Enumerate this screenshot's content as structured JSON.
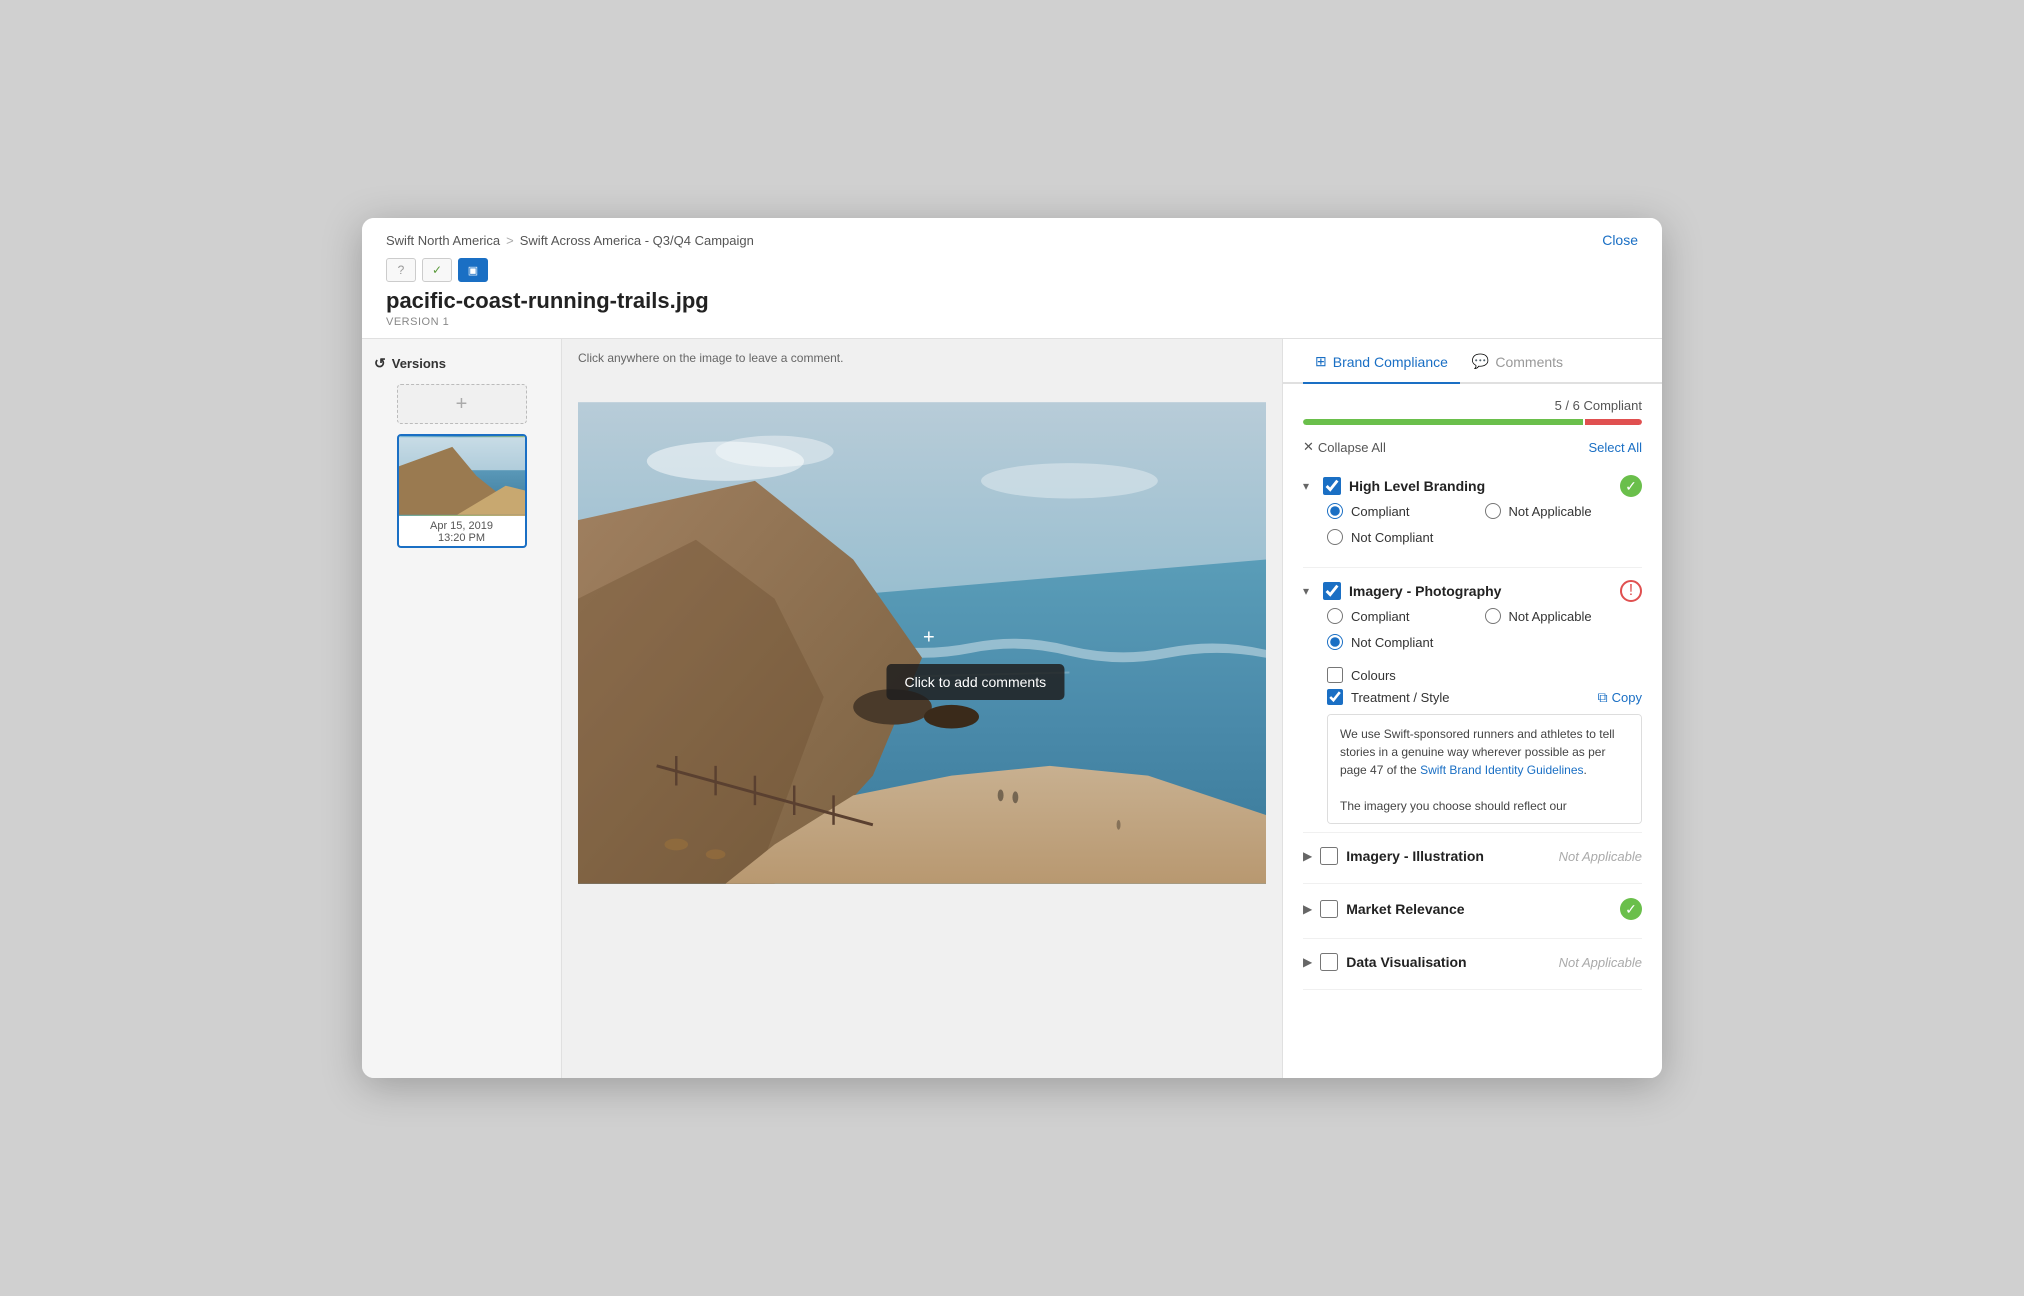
{
  "window": {
    "close_label": "Close"
  },
  "breadcrumb": {
    "root": "Swift North America",
    "separator": ">",
    "child": "Swift Across America - Q3/Q4 Campaign"
  },
  "file": {
    "name": "pacific-coast-running-trails.jpg",
    "version_label": "VERSION 1"
  },
  "icons": {
    "question_icon": "?",
    "approved_icon": "✓",
    "image_icon": "🖼"
  },
  "sidebar": {
    "versions_label": "Versions",
    "add_button": "+",
    "version_date": "Apr 15, 2019",
    "version_time": "13:20 PM"
  },
  "image_area": {
    "hint": "Click anywhere on the image to leave a comment.",
    "tooltip": "Click to add comments"
  },
  "right_panel": {
    "tab_compliance": "Brand Compliance",
    "tab_comments": "Comments",
    "score": "5 / 6 Compliant",
    "progress_green_pct": 83,
    "progress_red_pct": 17,
    "collapse_all": "Collapse All",
    "select_all": "Select All",
    "sections": [
      {
        "id": "high-level-branding",
        "title": "High Level Branding",
        "expanded": true,
        "checked": true,
        "status": "green",
        "options": [
          {
            "label": "Compliant",
            "name": "hlb",
            "selected": true
          },
          {
            "label": "Not Applicable",
            "name": "hlb",
            "selected": false
          },
          {
            "label": "Not Compliant",
            "name": "hlb",
            "selected": false
          }
        ]
      },
      {
        "id": "imagery-photography",
        "title": "Imagery - Photography",
        "expanded": true,
        "checked": true,
        "status": "red",
        "options": [
          {
            "label": "Compliant",
            "name": "ip",
            "selected": false
          },
          {
            "label": "Not Applicable",
            "name": "ip",
            "selected": false
          },
          {
            "label": "Not Compliant",
            "name": "ip",
            "selected": true
          }
        ],
        "checkboxes": [
          {
            "label": "Colours",
            "checked": false
          },
          {
            "label": "Treatment / Style",
            "checked": true
          }
        ],
        "guideline_text_1": "We use Swift-sponsored runners and athletes to tell stories in a genuine way wherever possible as per page 47 of the ",
        "guideline_link": "Swift Brand Identity Guidelines",
        "guideline_text_2": ".",
        "guideline_text_3": "The imagery you choose should reflect our",
        "copy_label": "Copy"
      },
      {
        "id": "imagery-illustration",
        "title": "Imagery - Illustration",
        "expanded": false,
        "checked": false,
        "status": "na",
        "not_applicable": "Not Applicable"
      },
      {
        "id": "market-relevance",
        "title": "Market Relevance",
        "expanded": false,
        "checked": false,
        "status": "green"
      },
      {
        "id": "data-visualisation",
        "title": "Data Visualisation",
        "expanded": false,
        "checked": false,
        "status": "na",
        "not_applicable": "Not Applicable"
      }
    ]
  }
}
